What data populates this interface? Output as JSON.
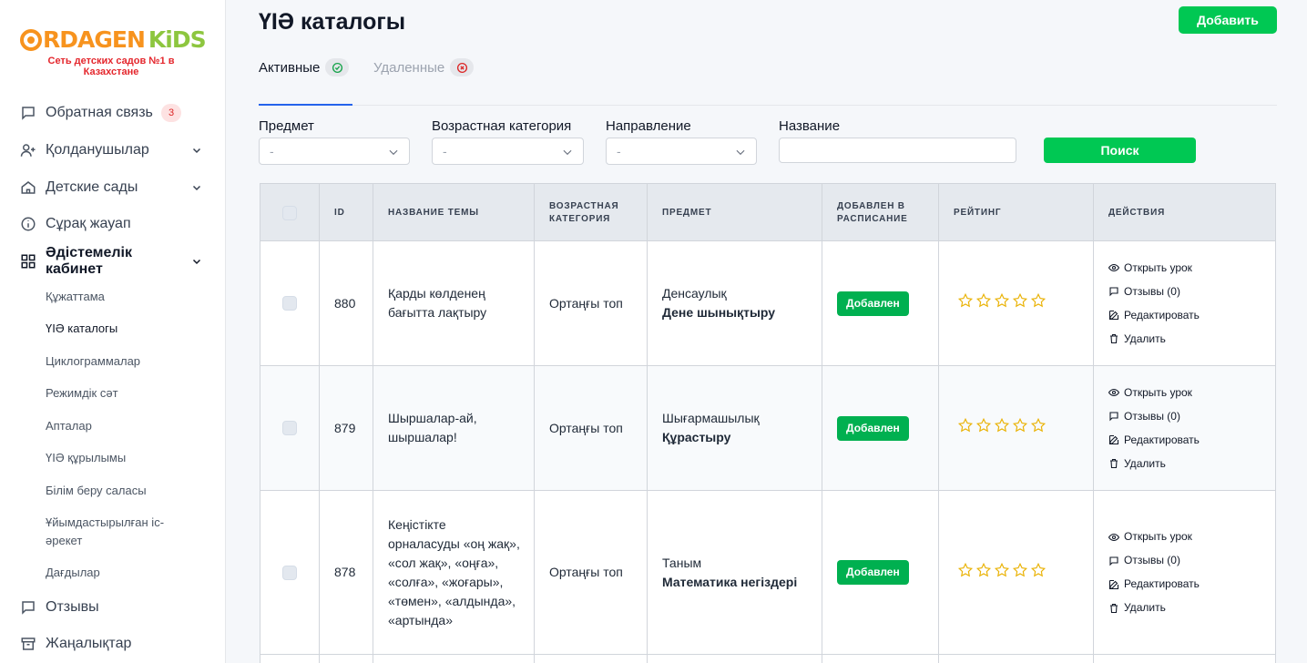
{
  "brand": {
    "logo_part1": "RDAGEN",
    "logo_part2": "KiDS",
    "tagline": "Сеть детских садов №1 в Казахстане",
    "colors": {
      "orange": "#f7931e",
      "green": "#8dc63f",
      "red": "#e4262c"
    }
  },
  "sidebar": {
    "items": [
      {
        "label": "Обратная связь",
        "icon": "chat-icon",
        "badge": "3"
      },
      {
        "label": "Қолданушылар",
        "icon": "user-add-icon"
      },
      {
        "label": "Детские сады",
        "icon": "home-icon"
      },
      {
        "label": "Сұрақ жауап",
        "icon": "info-icon"
      },
      {
        "label": "Әдістемелік кабинет",
        "icon": "grid-icon"
      },
      {
        "label": "Отзывы",
        "icon": "chat-icon"
      },
      {
        "label": "Жаңалықтар",
        "icon": "archive-icon"
      }
    ],
    "subitems": [
      "Құжаттама",
      "ҮІӘ каталогы",
      "Циклограммалар",
      "Режимдік сәт",
      "Апталар",
      "ҮІӘ құрылымы",
      "Білім беру саласы",
      "Ұйымдастырылған іс-әрекет",
      "Дағдылар"
    ]
  },
  "header": {
    "title": "ҮІӘ каталогы",
    "add_label": "Добавить"
  },
  "tabs": {
    "active": "Активные",
    "deleted": "Удаленные"
  },
  "filters": {
    "subject_label": "Предмет",
    "age_label": "Возрастная категория",
    "direction_label": "Направление",
    "name_label": "Название",
    "placeholder": "-",
    "search_label": "Поиск"
  },
  "table": {
    "headers": {
      "id": "ID",
      "name": "НАЗВАНИЕ ТЕМЫ",
      "age1": "ВОЗРАСТНАЯ",
      "age2": "КАТЕГОРИЯ",
      "subject": "ПРЕДМЕТ",
      "added1": "ДОБАВЛЕН В",
      "added2": "РАСПИСАНИЕ",
      "rating": "РЕЙТИНГ",
      "actions": "ДЕЙСТВИЯ"
    },
    "rows": [
      {
        "id": "880",
        "name": "Қарды көлденең бағытта лақтыру",
        "age": "Ортаңғы топ",
        "subject": "Денсаулық",
        "direction": "Дене шынықтыру",
        "status": "Добавлен",
        "rating": 0
      },
      {
        "id": "879",
        "name": "Шыршалар-ай, шыршалар!",
        "age": "Ортаңғы топ",
        "subject": "Шығармашылық",
        "direction": "Құрастыру",
        "status": "Добавлен",
        "rating": 0
      },
      {
        "id": "878",
        "name": "Кеңістікте орналасуды «оң жақ», «сол жақ», «оңға», «солға», «жоғары», «төмен», «алдында», «артында»",
        "age": "Ортаңғы топ",
        "subject": "Таным",
        "direction": "Математика негіздері",
        "status": "Добавлен",
        "rating": 0
      }
    ],
    "actions": {
      "open": "Открыть урок",
      "reviews": "Отзывы (0)",
      "edit": "Редактировать",
      "delete": "Удалить"
    }
  }
}
